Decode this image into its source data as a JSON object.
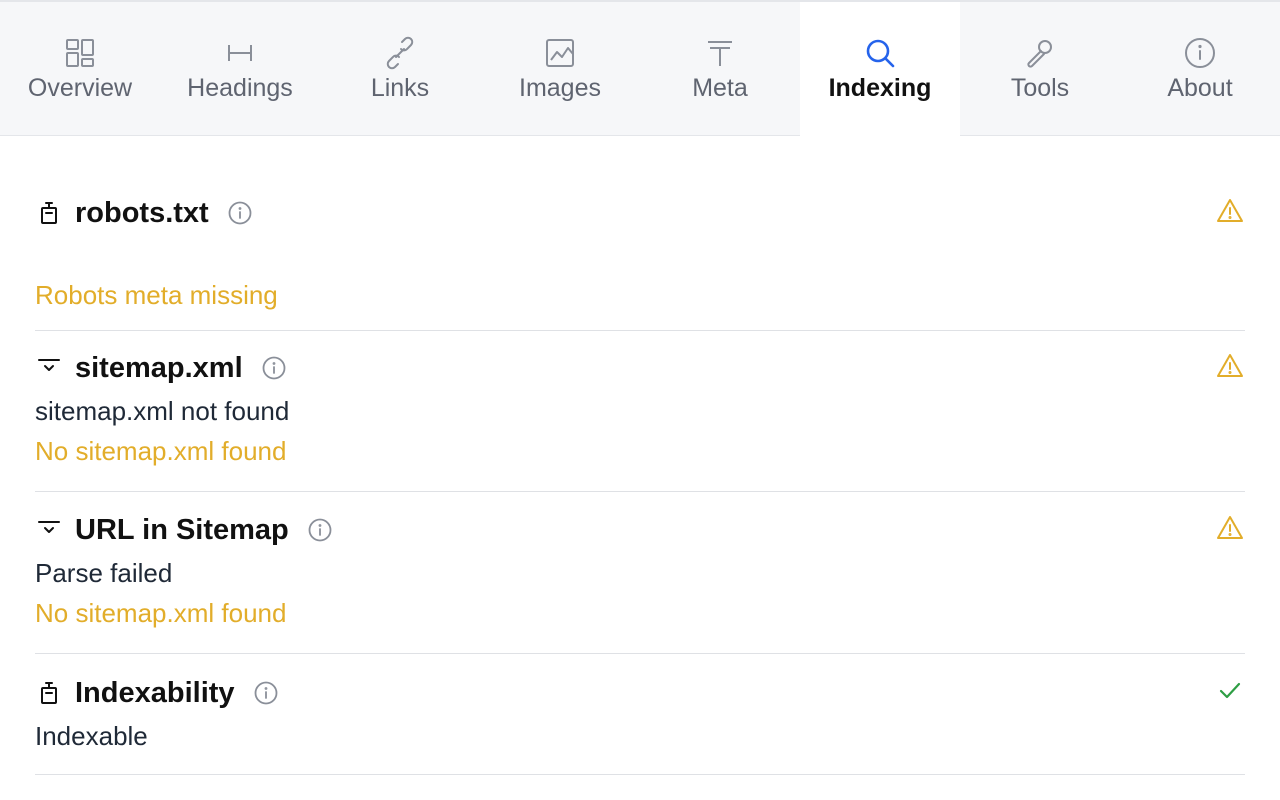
{
  "tabs": [
    {
      "label": "Overview",
      "icon": "dashboard-icon",
      "active": false
    },
    {
      "label": "Headings",
      "icon": "heading-icon",
      "active": false
    },
    {
      "label": "Links",
      "icon": "link-icon",
      "active": false
    },
    {
      "label": "Images",
      "icon": "image-icon",
      "active": false
    },
    {
      "label": "Meta",
      "icon": "text-icon",
      "active": false
    },
    {
      "label": "Indexing",
      "icon": "search-icon",
      "active": true
    },
    {
      "label": "Tools",
      "icon": "wrench-icon",
      "active": false
    },
    {
      "label": "About",
      "icon": "info-icon",
      "active": false
    }
  ],
  "sections": {
    "robots": {
      "title": "robots.txt",
      "icon": "robot-icon",
      "status": "warning",
      "lines": [
        "Robots meta missing"
      ]
    },
    "sitemap": {
      "title": "sitemap.xml",
      "icon": "sitemap-icon",
      "status": "warning",
      "lines": [
        "sitemap.xml not found",
        "No sitemap.xml found"
      ]
    },
    "url_in_sitemap": {
      "title": "URL in Sitemap",
      "icon": "sitemap-icon",
      "status": "warning",
      "lines": [
        "Parse failed",
        "No sitemap.xml found"
      ]
    },
    "indexability": {
      "title": "Indexability",
      "icon": "robot-icon",
      "status": "ok",
      "lines": [
        "Indexable"
      ]
    }
  },
  "colors": {
    "accent": "#2563eb",
    "warning": "#e2ad2a",
    "ok": "#2e9e44",
    "tab_bg": "#f6f7f9",
    "muted": "#5f6470"
  }
}
